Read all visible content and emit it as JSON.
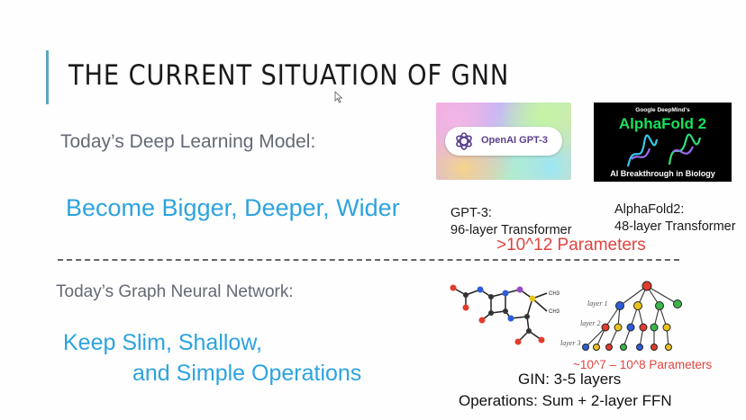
{
  "slide": {
    "title": "THE CURRENT SITUATION OF GNN",
    "deep_learning_label": "Today’s Deep Learning Model:",
    "deep_learning_trend": "Become Bigger, Deeper, Wider",
    "gnn_label": "Today’s Graph Neural Network:",
    "gnn_trend_line1": "Keep Slim, Shallow,",
    "gnn_trend_line2": "and Simple Operations"
  },
  "gpt3": {
    "logo_text": "OpenAI GPT-3",
    "caption_line1": "GPT-3:",
    "caption_line2": "96-layer Transformer"
  },
  "alphafold": {
    "top_text": "Google DeepMind's",
    "title": "AlphaFold 2",
    "bottom_text": "AI Breakthrough in Biology",
    "caption_line1": "AlphaFold2:",
    "caption_line2": "48-layer Transformer"
  },
  "parameters_big": ">10^12 Parameters",
  "parameters_gnn": "~10^7 – 10^8 Parameters",
  "gin": {
    "layers": "GIN: 3-5 layers",
    "operations": "Operations: Sum + 2-layer FFN"
  },
  "tree_labels": [
    "layer 1",
    "layer 2",
    "layer 3"
  ],
  "molecule_labels": [
    "N",
    "O",
    "H",
    "S",
    "CH3",
    "CH3"
  ],
  "colors": {
    "accent": "#5aa6c8",
    "blue_text": "#2da3df",
    "gray_text": "#636a76",
    "red_text": "#e0443f",
    "alphafold_green": "#19e05a"
  }
}
